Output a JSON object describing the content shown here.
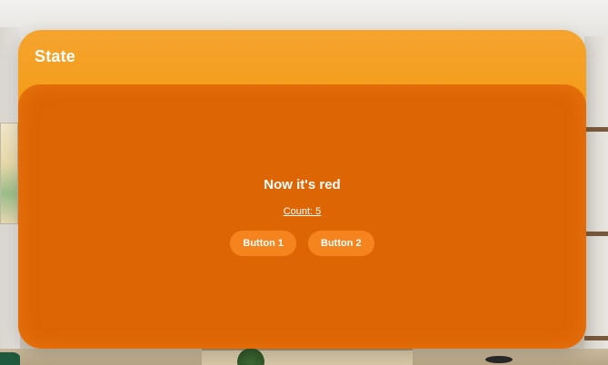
{
  "window": {
    "title": "State"
  },
  "content": {
    "headline": "Now it's red",
    "count_label": "Count: 5",
    "buttons": [
      {
        "label": "Button 1"
      },
      {
        "label": "Button 2"
      }
    ]
  },
  "colors": {
    "window_header": "#f59a12",
    "content_panel": "#dd6504",
    "button_fill": "#f5841f",
    "text": "#ffffff"
  }
}
